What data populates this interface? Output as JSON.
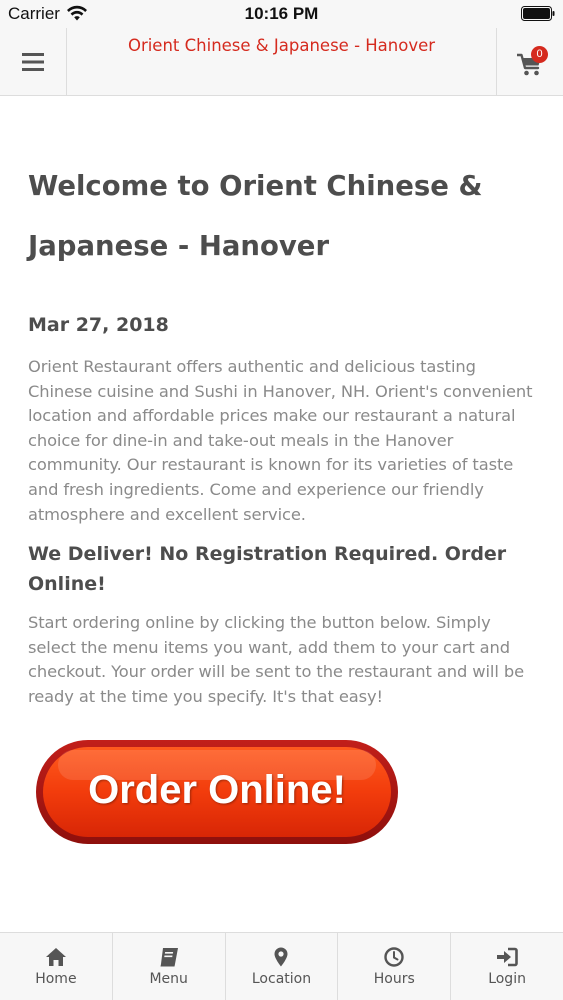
{
  "status_bar": {
    "carrier": "Carrier",
    "time": "10:16 PM"
  },
  "header": {
    "title": "Orient Chinese & Japanese - Hanover",
    "cart_count": "0",
    "menu_icon": "hamburger-icon",
    "cart_icon": "shopping-cart-icon"
  },
  "content": {
    "welcome_title_line1": "Welcome to Orient Chinese &",
    "welcome_title_line2": "Japanese - Hanover",
    "date": "Mar 27, 2018",
    "about": "Orient Restaurant offers authentic and delicious tasting Chinese cuisine and Sushi in Hanover, NH. Orient's convenient location and affordable prices make our restaurant a natural choice for dine-in and take-out meals in the Hanover community. Our restaurant is known for its varieties of taste and fresh ingredients. Come and experience our friendly atmosphere and excellent service.",
    "deliver_heading": "We Deliver! No Registration Required. Order Online!",
    "order_instructions": "Start ordering online by clicking the button below. Simply select the menu items you want, add them to your cart and checkout. Your order will be sent to the restaurant and will be ready at the time you specify. It's that easy!",
    "order_button_label": "Order Online!"
  },
  "tabs": [
    {
      "label": "Home",
      "icon": "home-icon"
    },
    {
      "label": "Menu",
      "icon": "book-icon"
    },
    {
      "label": "Location",
      "icon": "map-marker-icon"
    },
    {
      "label": "Hours",
      "icon": "clock-icon"
    },
    {
      "label": "Login",
      "icon": "sign-in-icon"
    }
  ],
  "colors": {
    "brand_red": "#d52a1e",
    "heading_gray": "#4d4d4d",
    "body_gray": "#8a8a8a",
    "bar_bg": "#f7f7f7",
    "button_red": "#e8290b"
  }
}
